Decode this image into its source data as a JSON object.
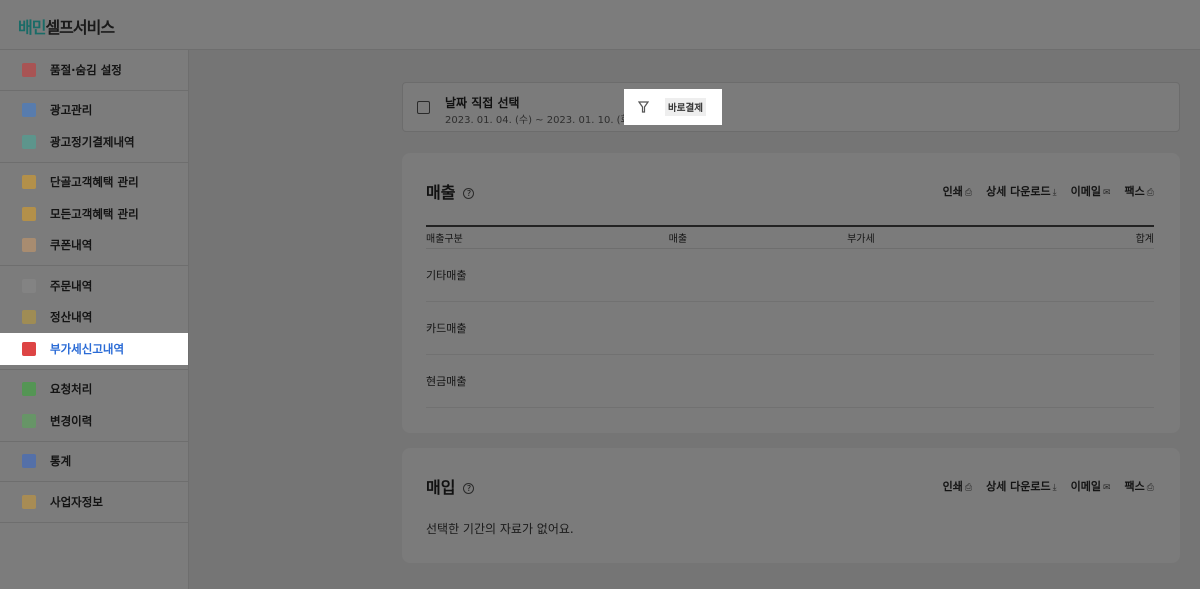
{
  "header": {
    "logo_accent": "배민",
    "logo_text": "셀프서비스"
  },
  "sidebar": {
    "groups": [
      [
        {
          "label": "품절·숨김 설정",
          "icon": "soldout-icon"
        }
      ],
      [
        {
          "label": "광고관리",
          "icon": "flag-icon"
        },
        {
          "label": "광고정기결제내역",
          "icon": "calendar-check-icon"
        }
      ],
      [
        {
          "label": "단골고객혜택 관리",
          "icon": "coupon-icon"
        },
        {
          "label": "모든고객혜택 관리",
          "icon": "coupon-icon"
        },
        {
          "label": "쿠폰내역",
          "icon": "receipt-icon"
        }
      ],
      [
        {
          "label": "주문내역",
          "icon": "order-icon"
        },
        {
          "label": "정산내역",
          "icon": "settlement-icon"
        },
        {
          "label": "부가세신고내역",
          "icon": "tax-report-icon",
          "active": true
        }
      ],
      [
        {
          "label": "요청처리",
          "icon": "check-icon"
        },
        {
          "label": "변경이력",
          "icon": "history-icon"
        }
      ],
      [
        {
          "label": "통계",
          "icon": "chart-icon"
        }
      ],
      [
        {
          "label": "사업자정보",
          "icon": "business-icon"
        }
      ]
    ]
  },
  "date": {
    "title": "날짜 직접 선택",
    "range": "2023. 01. 04. (수) ~ 2023. 01. 10. (화)"
  },
  "filter": {
    "chip": "바로결제"
  },
  "actions": {
    "print": "인쇄",
    "download": "상세 다운로드",
    "email": "이메일",
    "fax": "팩스"
  },
  "sales": {
    "title": "매출",
    "columns": [
      "매출구분",
      "매출",
      "부가세",
      "합계"
    ],
    "rows": [
      "기타매출",
      "카드매출",
      "현금매출"
    ]
  },
  "purchase": {
    "title": "매입",
    "empty": "선택한 기간의 자료가 없어요."
  },
  "colors": {
    "accent": "#2ac1bc",
    "active": "#2a6bd6"
  }
}
